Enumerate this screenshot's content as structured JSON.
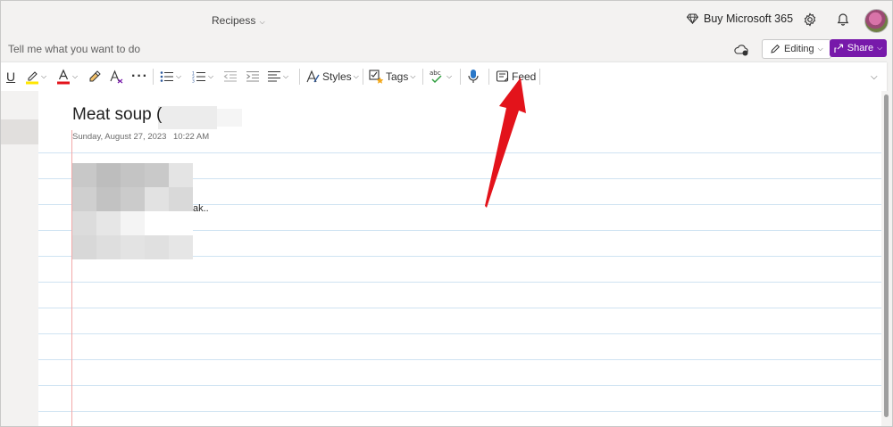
{
  "titlebar": {
    "doc_title": "Recipess",
    "buy_label": "Buy Microsoft 365"
  },
  "tellrow": {
    "tell_me": "Tell me what you want to do",
    "editing_label": "Editing",
    "share_label": "Share"
  },
  "ribbon": {
    "underline_label": "U",
    "styles_label": "Styles",
    "tags_label": "Tags",
    "spell_label": "abc",
    "feed_label": "Feed"
  },
  "note": {
    "title": "Meat soup (",
    "date": "Sunday, August 27, 2023",
    "time": "10:22 AM",
    "body_fragment": "ak.."
  },
  "icons": [
    "diamond-icon",
    "gear-icon",
    "bell-icon",
    "avatar",
    "cloud-sync-icon",
    "pencil-icon",
    "share-chevron-icon",
    "highlighter-icon",
    "font-color-icon",
    "format-painter-icon",
    "clear-format-icon",
    "more-icon",
    "bullets-icon",
    "numbering-icon",
    "outdent-icon",
    "indent-icon",
    "align-icon",
    "styles-icon",
    "tags-icon",
    "spelling-icon",
    "dictate-mic-icon",
    "feed-icon",
    "ribbon-expand-icon"
  ],
  "colors": {
    "share_bg": "#7719aa",
    "annotation_arrow": "#e3131b",
    "highlight_yellow": "#ffe600",
    "font_red": "#e3131b"
  }
}
